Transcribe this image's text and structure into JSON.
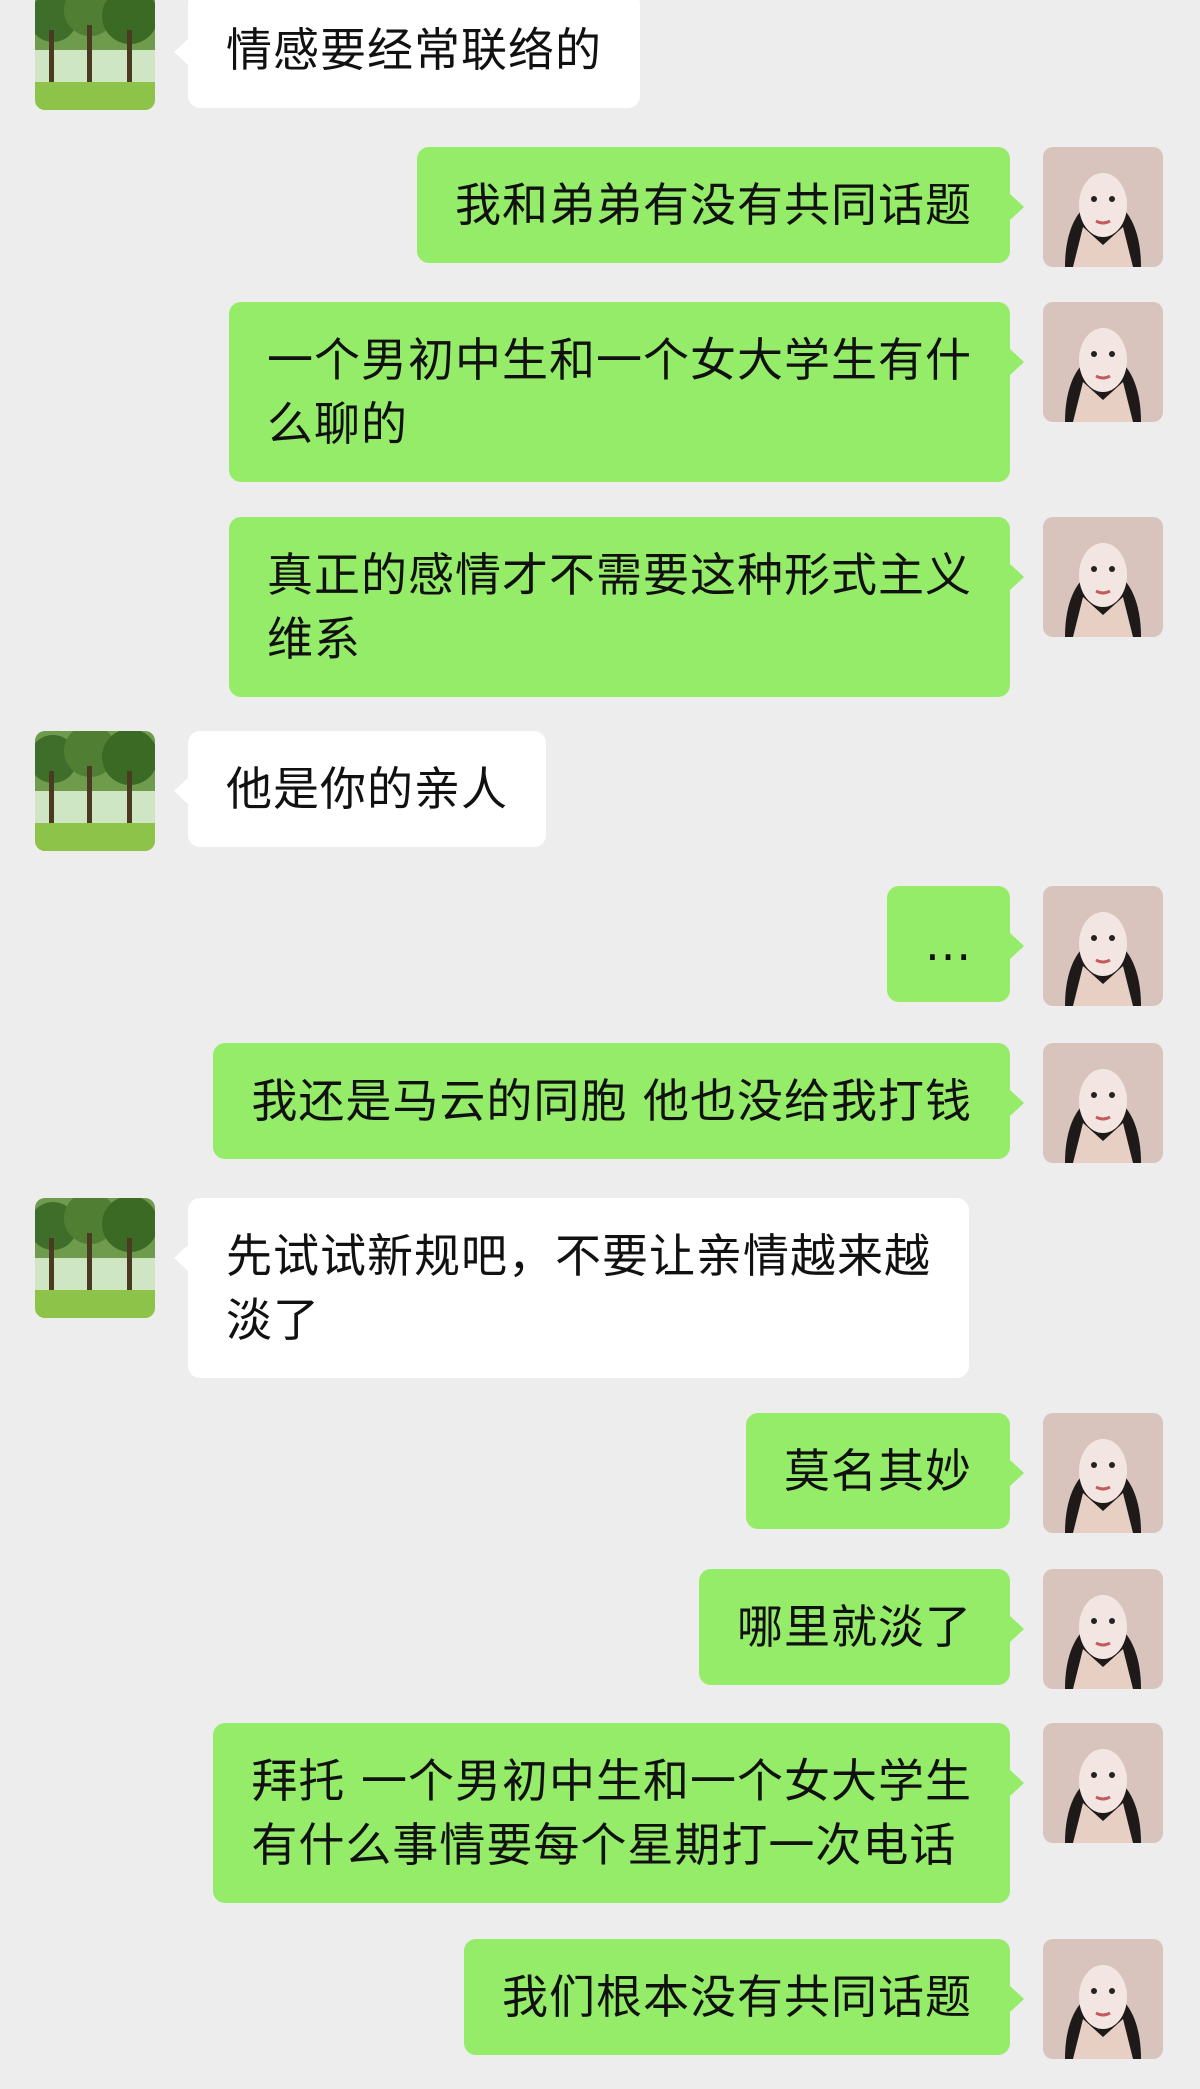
{
  "messages": [
    {
      "side": "left",
      "text": "情感要经常联络的"
    },
    {
      "side": "right",
      "text": "我和弟弟有没有共同话题"
    },
    {
      "side": "right",
      "text": "一个男初中生和一个女大学生有什\n么聊的"
    },
    {
      "side": "right",
      "text": "真正的感情才不需要这种形式主义\n维系"
    },
    {
      "side": "left",
      "text": "他是你的亲人"
    },
    {
      "side": "right",
      "text": "..."
    },
    {
      "side": "right",
      "text": "我还是马云的同胞 他也没给我打钱"
    },
    {
      "side": "left",
      "text": "先试试新规吧，不要让亲情越来越\n淡了"
    },
    {
      "side": "right",
      "text": "莫名其妙"
    },
    {
      "side": "right",
      "text": "哪里就淡了"
    },
    {
      "side": "right",
      "text": "拜托 一个男初中生和一个女大学生\n有什么事情要每个星期打一次电话"
    },
    {
      "side": "right",
      "text": "我们根本没有共同话题"
    }
  ],
  "avatars": {
    "left": "forest-landscape-avatar",
    "right": "woman-portrait-avatar"
  },
  "colors": {
    "background": "#ededed",
    "self_bubble": "#95ec69",
    "other_bubble": "#ffffff"
  }
}
